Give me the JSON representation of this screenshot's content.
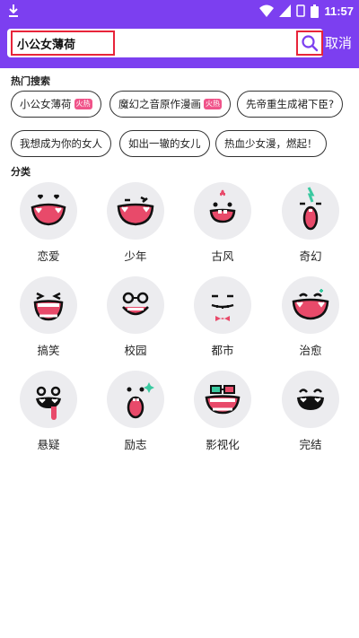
{
  "status_bar": {
    "time": "11:57"
  },
  "search": {
    "query": "小公女薄荷",
    "cancel_label": "取消"
  },
  "hot_search": {
    "title": "热门搜索",
    "items": [
      {
        "label": "小公女薄荷",
        "badge": "火热"
      },
      {
        "label": "魔幻之音原作漫画",
        "badge": "火热"
      },
      {
        "label": "先帝重生成裙下臣?",
        "badge": null
      },
      {
        "label": "我想成为你的女人",
        "badge": null
      },
      {
        "label": "如出一辙的女儿",
        "badge": null
      },
      {
        "label": "热血少女漫，燃起！",
        "badge": null
      }
    ]
  },
  "categories": {
    "title": "分类",
    "items": [
      {
        "label": "恋爱",
        "icon": "love-face-icon"
      },
      {
        "label": "少年",
        "icon": "youth-face-icon"
      },
      {
        "label": "古风",
        "icon": "ancient-face-icon"
      },
      {
        "label": "奇幻",
        "icon": "fantasy-face-icon"
      },
      {
        "label": "搞笑",
        "icon": "funny-face-icon"
      },
      {
        "label": "校园",
        "icon": "campus-face-icon"
      },
      {
        "label": "都市",
        "icon": "urban-face-icon"
      },
      {
        "label": "治愈",
        "icon": "healing-face-icon"
      },
      {
        "label": "悬疑",
        "icon": "mystery-face-icon"
      },
      {
        "label": "励志",
        "icon": "inspirational-face-icon"
      },
      {
        "label": "影视化",
        "icon": "adaptation-face-icon"
      },
      {
        "label": "完结",
        "icon": "completed-face-icon"
      }
    ]
  },
  "colors": {
    "header": "#7c3ff0",
    "highlight_border": "#e8243a",
    "badge": "#f0548a",
    "mouth": "#e84a6a",
    "tile": "#ececef"
  }
}
